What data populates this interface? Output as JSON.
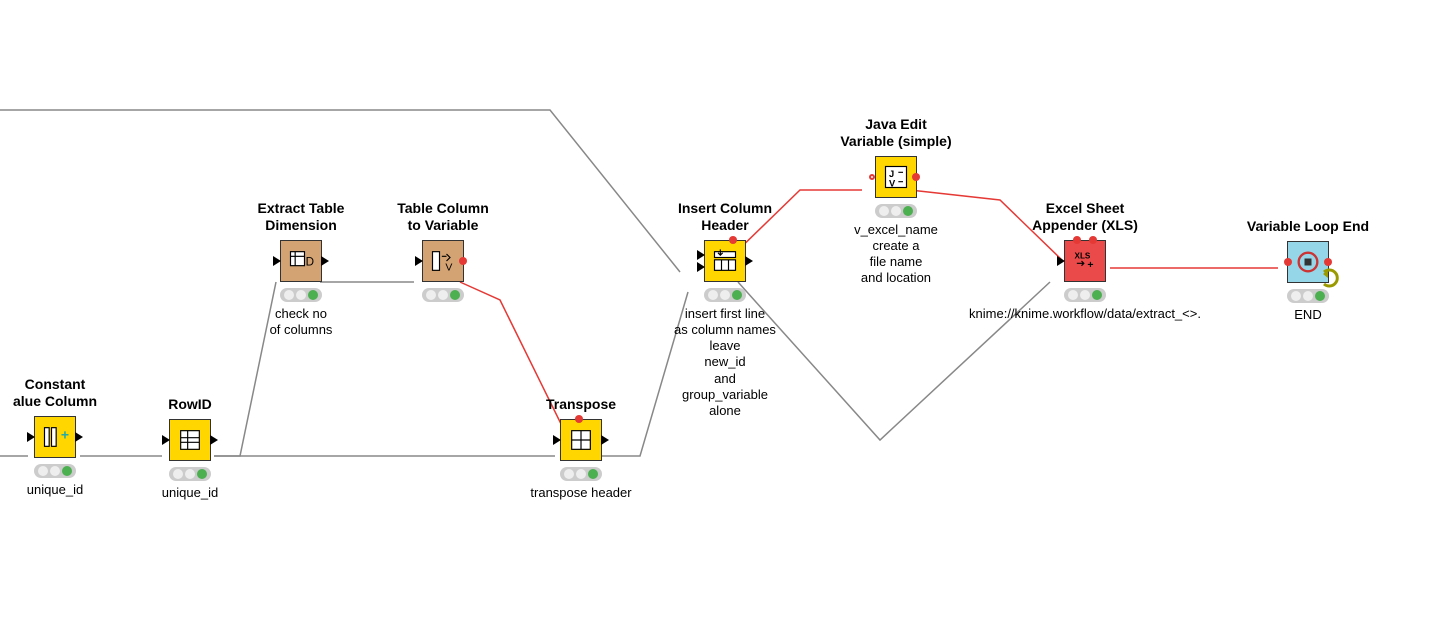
{
  "nodes": {
    "constant": {
      "title": "Constant\nalue Column",
      "desc": "unique_id"
    },
    "rowid": {
      "title": "RowID",
      "desc": "unique_id"
    },
    "extract": {
      "title": "Extract Table\nDimension",
      "desc": "check no\nof columns"
    },
    "tabcol": {
      "title": "Table Column\nto Variable",
      "desc": ""
    },
    "transpose": {
      "title": "Transpose",
      "desc": "transpose header"
    },
    "insert": {
      "title": "Insert Column\nHeader",
      "desc": "insert first line\nas column names\nleave\nnew_id\nand\ngroup_variable\nalone"
    },
    "java": {
      "title": "Java Edit\nVariable (simple)",
      "desc": "v_excel_name\ncreate a\nfile name\nand location"
    },
    "excel": {
      "title": "Excel Sheet\nAppender (XLS)",
      "desc": "knime://knime.workflow/data/extract_<>."
    },
    "loopend": {
      "title": "Variable Loop End",
      "desc": "END"
    }
  },
  "colors": {
    "yellow": "#ffd600",
    "tan": "#d4a374",
    "red": "#ea4a4a",
    "blue": "#95d6e8",
    "varRed": "#e53935",
    "statusGreen": "#4caf50"
  }
}
